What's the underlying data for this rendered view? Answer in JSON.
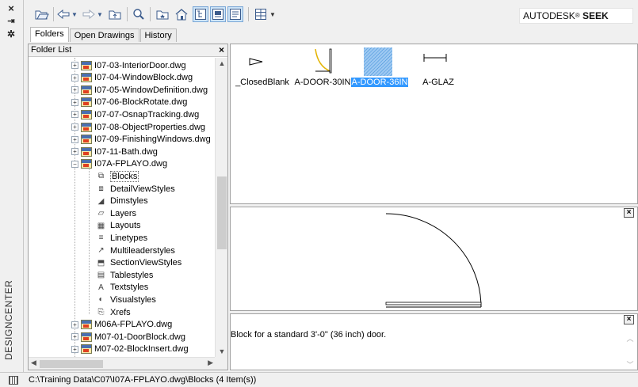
{
  "window": {
    "title": "DESIGNCENTER",
    "brand_prefix": "AUTODESK",
    "brand_mark": "®",
    "brand_suffix": "SEEK"
  },
  "side_controls": {
    "close": "×",
    "pin": "⇥",
    "properties": "✲"
  },
  "toolbar": {
    "icons": [
      "open-icon",
      "back-icon",
      "back-dropdown-icon",
      "forward-icon",
      "forward-dropdown-icon",
      "up-icon",
      "search-icon",
      "favorites-icon",
      "home-icon",
      "tree-view-toggle-icon",
      "preview-toggle-icon",
      "description-toggle-icon",
      "views-icon",
      "views-dropdown-icon"
    ]
  },
  "tabs": [
    "Folders",
    "Open Drawings",
    "History"
  ],
  "folder_list": {
    "header": "Folder List",
    "close": "×",
    "items": [
      {
        "label": "I07-03-InteriorDoor.dwg",
        "kind": "dwg"
      },
      {
        "label": "I07-04-WindowBlock.dwg",
        "kind": "dwg"
      },
      {
        "label": "I07-05-WindowDefinition.dwg",
        "kind": "dwg"
      },
      {
        "label": "I07-06-BlockRotate.dwg",
        "kind": "dwg"
      },
      {
        "label": "I07-07-OsnapTracking.dwg",
        "kind": "dwg"
      },
      {
        "label": "I07-08-ObjectProperties.dwg",
        "kind": "dwg"
      },
      {
        "label": "I07-09-FinishingWindows.dwg",
        "kind": "dwg"
      },
      {
        "label": "I07-11-Bath.dwg",
        "kind": "dwg"
      },
      {
        "label": "I07A-FPLAYO.dwg",
        "kind": "dwg",
        "expanded": true
      },
      {
        "label": "Blocks",
        "kind": "child",
        "icon": "blocks-icon",
        "selected": true
      },
      {
        "label": "DetailViewStyles",
        "kind": "child",
        "icon": "detail-view-styles-icon"
      },
      {
        "label": "Dimstyles",
        "kind": "child",
        "icon": "dimstyles-icon"
      },
      {
        "label": "Layers",
        "kind": "child",
        "icon": "layers-icon"
      },
      {
        "label": "Layouts",
        "kind": "child",
        "icon": "layouts-icon"
      },
      {
        "label": "Linetypes",
        "kind": "child",
        "icon": "linetypes-icon"
      },
      {
        "label": "Multileaderstyles",
        "kind": "child",
        "icon": "multileaderstyles-icon"
      },
      {
        "label": "SectionViewStyles",
        "kind": "child",
        "icon": "section-view-styles-icon"
      },
      {
        "label": "Tablestyles",
        "kind": "child",
        "icon": "tablestyles-icon"
      },
      {
        "label": "Textstyles",
        "kind": "child",
        "icon": "textstyles-icon"
      },
      {
        "label": "Visualstyles",
        "kind": "child",
        "icon": "visualstyles-icon"
      },
      {
        "label": "Xrefs",
        "kind": "child",
        "icon": "xrefs-icon"
      },
      {
        "label": "M06A-FPLAYO.dwg",
        "kind": "dwg"
      },
      {
        "label": "M07-01-DoorBlock.dwg",
        "kind": "dwg"
      },
      {
        "label": "M07-02-BlockInsert.dwg",
        "kind": "dwg"
      }
    ]
  },
  "content_items": [
    {
      "label": "_ClosedBlank",
      "icon": "closed-blank-arrow-icon",
      "selected": false
    },
    {
      "label": "A-DOOR-30IN",
      "icon": "door-30-icon",
      "selected": false
    },
    {
      "label": "A-DOOR-36IN",
      "icon": "door-36-icon",
      "selected": true
    },
    {
      "label": "A-GLAZ",
      "icon": "glazing-icon",
      "selected": false
    }
  ],
  "preview": {
    "close": "×"
  },
  "description": {
    "text": "Block for a standard 3'-0\" (36 inch) door.",
    "close": "×"
  },
  "status": {
    "path": "C:\\Training Data\\C07\\I07A-FPLAYO.dwg\\Blocks (4 Item(s))"
  },
  "colors": {
    "selection": "#3399ff",
    "border": "#a0a0a0",
    "toolbar_active": "#cde4f7"
  }
}
